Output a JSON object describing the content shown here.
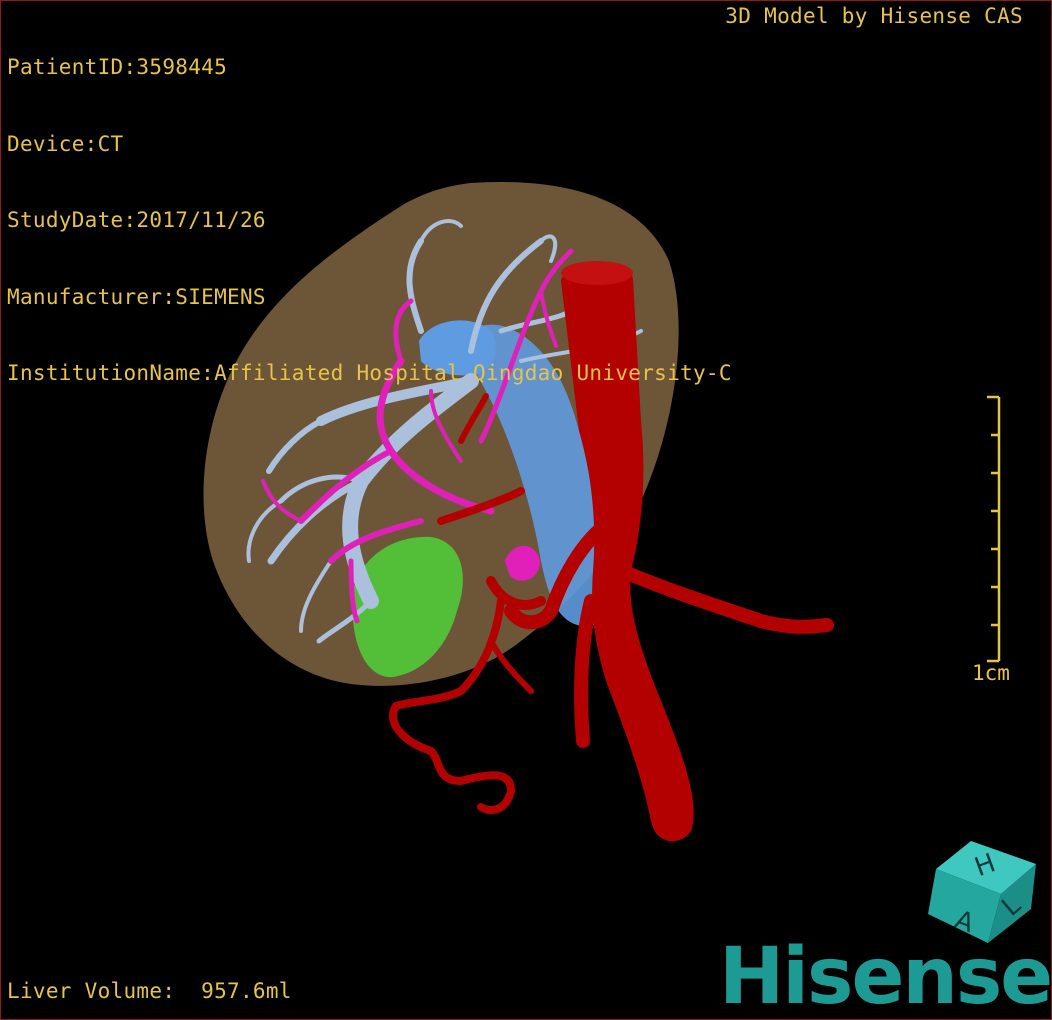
{
  "patient_info": {
    "patient_id": "PatientID:3598445",
    "device": "Device:CT",
    "study_date": "StudyDate:2017/11/26",
    "manufacturer": "Manufacturer:SIEMENS",
    "institution": "InstitutionName:Affiliated Hospital Qingdao University-C"
  },
  "credit": "3D Model by Hisense CAS",
  "scale_bar": {
    "label": "1cm"
  },
  "liver_volume": "Liver Volume:  957.6ml",
  "orientation_cube": {
    "top_label": "H",
    "left_label": "A",
    "right_label": "L"
  },
  "brand": "Hisense",
  "colors": {
    "overlay_text": "#e8c34a",
    "liver": "#b08a5a",
    "aorta": "#b30000",
    "portal_vein": "#aac0dc",
    "hepatic_vein": "#e020b8",
    "ivc": "#5f9be0",
    "gallbladder": "#4fd13a",
    "brand": "#1d9a94"
  },
  "icons": {
    "orientation": "orientation-cube-icon",
    "scale": "scale-bar-icon"
  }
}
